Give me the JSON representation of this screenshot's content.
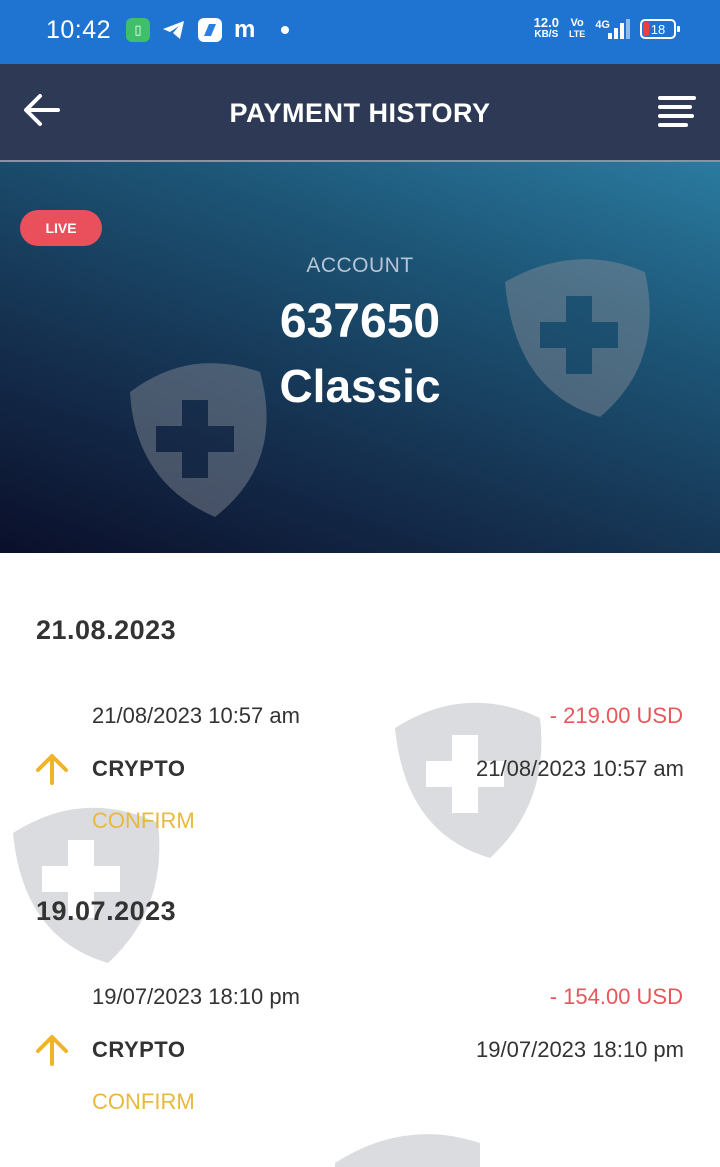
{
  "status_bar": {
    "time": "10:42",
    "net_speed": "12.0",
    "net_speed_unit": "KB/S",
    "volte_top": "Vo",
    "volte_bottom": "LTE",
    "network_type": "4G",
    "battery_level": "18",
    "icons": [
      "battery-saver-app-icon",
      "telegram-icon",
      "blue-app-icon",
      "m-app-icon",
      "notification-dot-icon",
      "signal-icon",
      "battery-icon"
    ]
  },
  "header": {
    "title": "PAYMENT HISTORY",
    "icons": [
      "back-arrow-icon",
      "menu-icon"
    ]
  },
  "account": {
    "badge": "LIVE",
    "label": "ACCOUNT",
    "number": "637650",
    "type": "Classic"
  },
  "history": [
    {
      "date": "21.08.2023",
      "transactions": [
        {
          "datetime": "21/08/2023 10:57 am",
          "amount": "- 219.00 USD",
          "method": "CRYPTO",
          "datetime_right": "21/08/2023 10:57 am",
          "status": "CONFIRM",
          "icon": "arrow-up-icon"
        }
      ]
    },
    {
      "date": "19.07.2023",
      "transactions": [
        {
          "datetime": "19/07/2023 18:10 pm",
          "amount": "- 154.00 USD",
          "method": "CRYPTO",
          "datetime_right": "19/07/2023 18:10 pm",
          "status": "CONFIRM",
          "icon": "arrow-up-icon"
        }
      ]
    }
  ],
  "colors": {
    "status_bar": "#1f74d2",
    "header": "#2e3a55",
    "live_badge": "#e9505b",
    "amount": "#e8555b",
    "confirm": "#e8b93a",
    "arrow": "#f0b428"
  }
}
